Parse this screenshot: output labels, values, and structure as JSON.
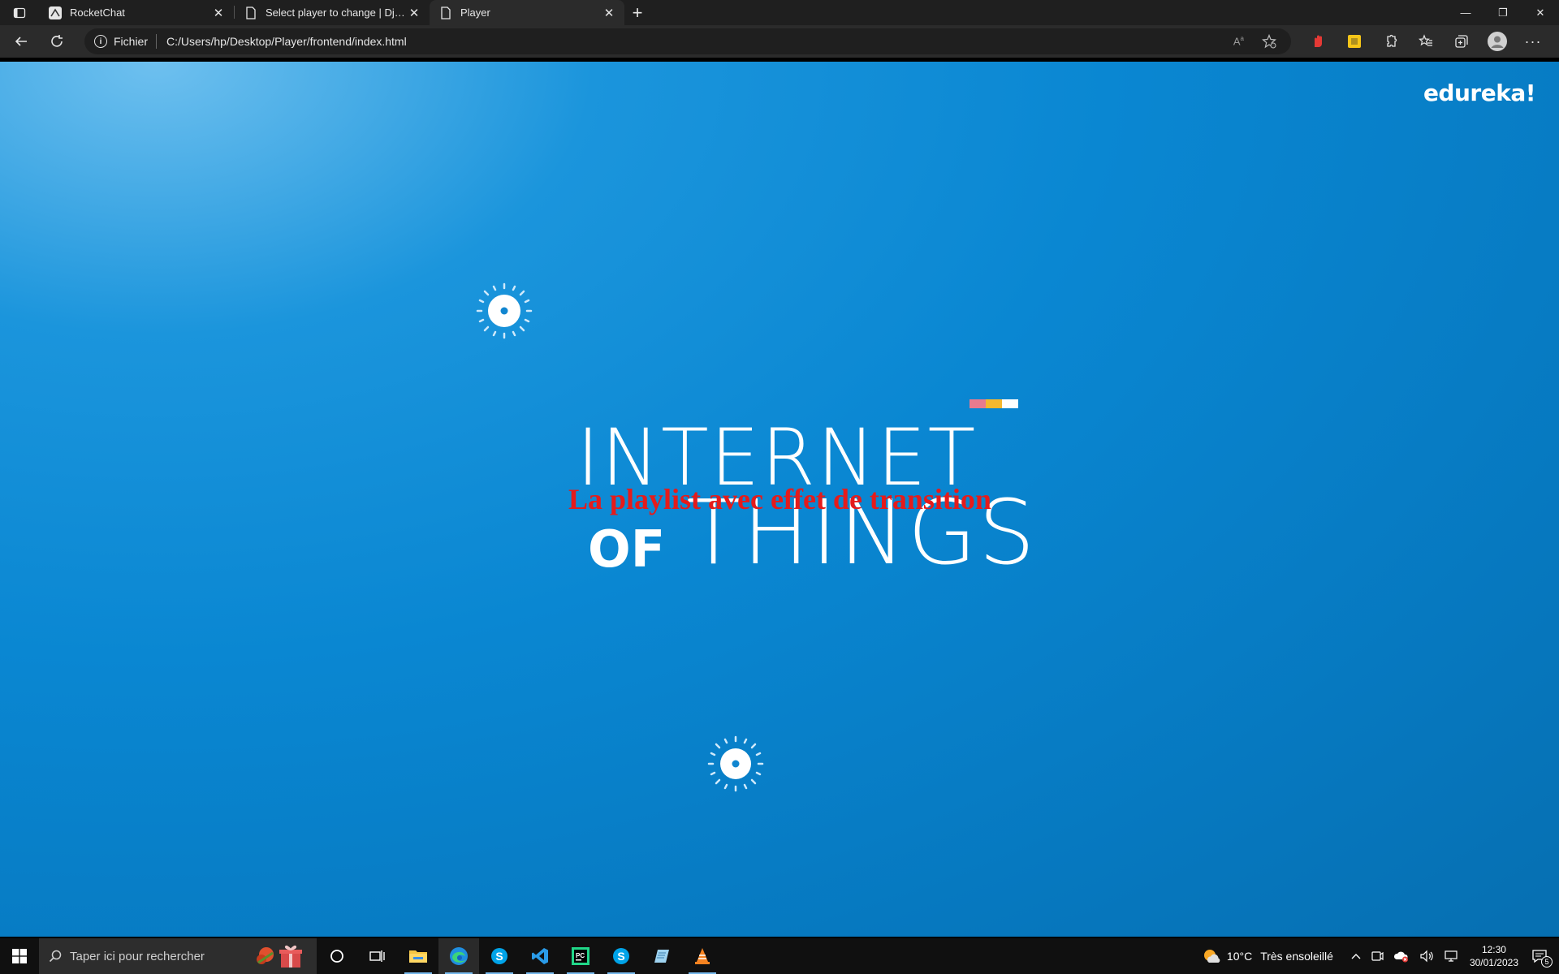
{
  "browser": {
    "tabs": [
      {
        "title": "RocketChat",
        "active": false
      },
      {
        "title": "Select player to change | Django",
        "active": false
      },
      {
        "title": "Player",
        "active": true
      }
    ],
    "address": {
      "scheme_label": "Fichier",
      "url": "C:/Users/hp/Desktop/Player/frontend/index.html"
    }
  },
  "page": {
    "brand": "edureka!",
    "video_title_line1": "INTERNET",
    "video_title_of": "OF",
    "video_title_line2": "THINGS",
    "overlay_title": "La playlist avec effet de transition",
    "colors": {
      "overlay_title": "#e51b1b",
      "bar_pink": "#e87b8e",
      "bar_yellow": "#f5b82e",
      "bar_white": "#ffffff"
    }
  },
  "taskbar": {
    "search_placeholder": "Taper ici pour rechercher",
    "weather": {
      "temp": "10°C",
      "condition": "Très ensoleillé"
    },
    "time": "12:30",
    "date": "30/01/2023",
    "notifications": "5",
    "apps": [
      "task-view",
      "file-explorer",
      "edge",
      "skype",
      "vscode",
      "pycharm",
      "skype",
      "notepad",
      "vlc"
    ]
  }
}
